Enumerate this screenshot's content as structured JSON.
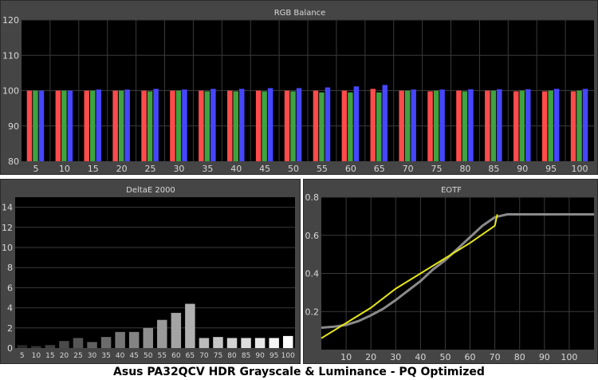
{
  "caption": "Asus PA32QCV HDR Grayscale & Luminance - PQ Optimized",
  "colors": {
    "panel_bg": "#454545",
    "plot_bg": "#000000",
    "grid": "#3a3a3a",
    "red": "#ff4b4b",
    "green": "#3fa33f",
    "blue": "#4646ff",
    "eotf_target": "#8a8a8a",
    "eotf_measured": "#e6e619"
  },
  "chart_data": [
    {
      "type": "bar",
      "title": "RGB Balance",
      "categories": [
        "5",
        "10",
        "15",
        "20",
        "25",
        "30",
        "35",
        "40",
        "45",
        "50",
        "55",
        "60",
        "65",
        "70",
        "75",
        "80",
        "85",
        "90",
        "95",
        "100"
      ],
      "ylim": [
        80,
        120
      ],
      "yticks": [
        80,
        90,
        100,
        110,
        120
      ],
      "series": [
        {
          "color": "red",
          "values": [
            100.0,
            100.0,
            100.0,
            100.0,
            100.0,
            100.0,
            100.0,
            100.0,
            100.0,
            100.0,
            100.0,
            100.0,
            100.5,
            100.0,
            99.8,
            100.0,
            100.0,
            99.8,
            99.8,
            99.8
          ]
        },
        {
          "color": "green",
          "values": [
            100.0,
            100.0,
            100.0,
            100.0,
            99.8,
            100.0,
            99.8,
            99.8,
            99.8,
            99.8,
            99.5,
            99.5,
            99.5,
            100.0,
            100.0,
            99.8,
            100.0,
            100.0,
            100.0,
            100.0
          ]
        },
        {
          "color": "blue",
          "values": [
            100.0,
            100.0,
            100.3,
            100.3,
            100.5,
            100.3,
            100.5,
            100.5,
            100.7,
            100.7,
            100.9,
            101.2,
            101.6,
            100.3,
            100.3,
            100.4,
            100.4,
            100.4,
            100.5,
            100.5
          ]
        }
      ]
    },
    {
      "type": "bar",
      "title": "DeltaE 2000",
      "categories": [
        "5",
        "10",
        "15",
        "20",
        "25",
        "30",
        "35",
        "40",
        "45",
        "50",
        "55",
        "60",
        "65",
        "70",
        "75",
        "80",
        "85",
        "90",
        "95",
        "100"
      ],
      "ylim": [
        0,
        15
      ],
      "yticks": [
        0,
        2,
        4,
        6,
        8,
        10,
        12,
        14
      ],
      "values": [
        0.3,
        0.2,
        0.3,
        0.7,
        1.0,
        0.6,
        1.1,
        1.6,
        1.6,
        2.0,
        2.8,
        3.5,
        4.4,
        1.0,
        1.1,
        1.0,
        1.0,
        1.0,
        1.0,
        1.2
      ]
    },
    {
      "type": "line",
      "title": "EOTF",
      "xlim": [
        0,
        110
      ],
      "ylim": [
        0,
        0.8
      ],
      "xticks": [
        10,
        20,
        30,
        40,
        50,
        60,
        70,
        80,
        90,
        100
      ],
      "yticks": [
        0.2,
        0.4,
        0.6,
        0.8
      ],
      "series": [
        {
          "color": "eotf_target",
          "x": [
            0,
            5,
            10,
            15,
            20,
            25,
            30,
            35,
            40,
            45,
            50,
            55,
            60,
            65,
            70,
            75,
            80,
            85,
            90,
            95,
            100,
            105,
            110
          ],
          "y": [
            0.115,
            0.12,
            0.13,
            0.15,
            0.18,
            0.215,
            0.26,
            0.31,
            0.36,
            0.42,
            0.47,
            0.53,
            0.59,
            0.65,
            0.695,
            0.71,
            0.71,
            0.71,
            0.71,
            0.71,
            0.71,
            0.71,
            0.71
          ]
        },
        {
          "color": "eotf_measured",
          "x": [
            0,
            10,
            20,
            30,
            40,
            50,
            60,
            70,
            71
          ],
          "y": [
            0.06,
            0.14,
            0.22,
            0.32,
            0.4,
            0.48,
            0.56,
            0.65,
            0.71
          ]
        }
      ]
    }
  ]
}
